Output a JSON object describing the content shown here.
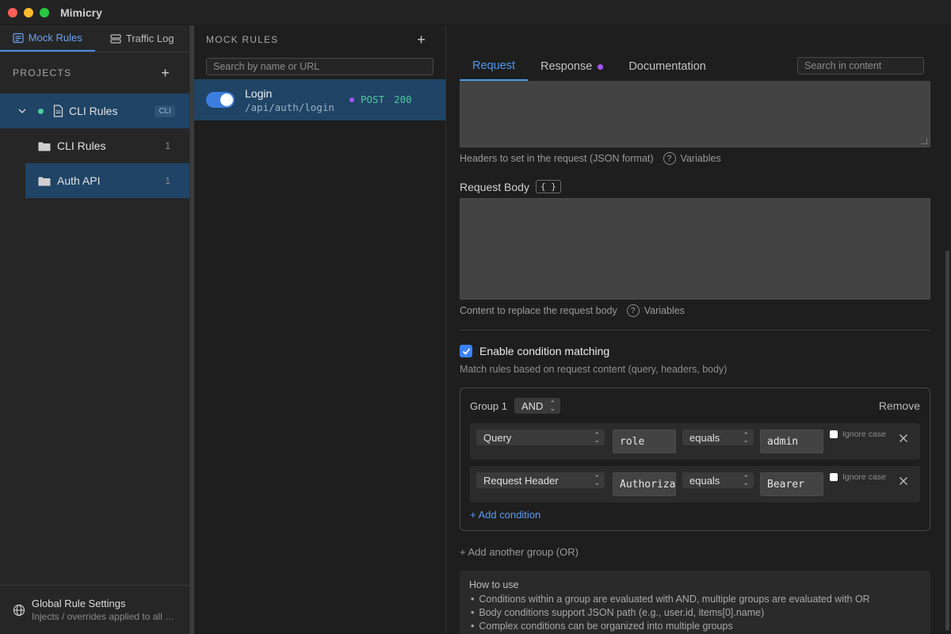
{
  "app": {
    "title": "Mimicry"
  },
  "sidebar": {
    "tabs": [
      {
        "label": "Mock Rules",
        "icon": "list-icon"
      },
      {
        "label": "Traffic Log",
        "icon": "server-icon"
      }
    ],
    "projects_label": "PROJECTS",
    "project": {
      "name": "CLI Rules",
      "badge": "CLI",
      "icon": "file-icon"
    },
    "folders": [
      {
        "name": "CLI Rules",
        "count": "1"
      },
      {
        "name": "Auth API",
        "count": "1"
      }
    ],
    "footer": {
      "title": "Global Rule Settings",
      "subtitle": "Injects / overrides applied to all rules",
      "icon": "globe-icon"
    }
  },
  "rules_panel": {
    "title": "MOCK RULES",
    "search_placeholder": "Search by name or URL",
    "rules": [
      {
        "name": "Login",
        "url": "/api/auth/login",
        "method": "POST",
        "status": "200",
        "enabled": true
      }
    ]
  },
  "main": {
    "tabs": [
      {
        "label": "Request"
      },
      {
        "label": "Response"
      },
      {
        "label": "Documentation"
      }
    ],
    "search_placeholder": "Search in content",
    "headers_hint": "Headers to set in the request (JSON format)",
    "variables_label": "Variables",
    "request_body_label": "Request Body",
    "braces_label": "{ }",
    "body_hint": "Content to replace the request body",
    "condition": {
      "title": "Enable condition matching",
      "description": "Match rules based on request content (query, headers, body)",
      "group": {
        "label": "Group 1",
        "operator": "AND",
        "remove_label": "Remove",
        "rows": [
          {
            "source": "Query",
            "key": "role",
            "op": "equals",
            "value": "admin",
            "ignore_case": "Ignore case"
          },
          {
            "source": "Request Header",
            "key": "Authorization",
            "op": "equals",
            "value": "Bearer",
            "ignore_case": "Ignore case"
          }
        ],
        "add_condition": "+ Add condition"
      },
      "add_group": "+ Add another group (OR)"
    },
    "howto": {
      "title": "How to use",
      "items": [
        "Conditions within a group are evaluated with AND, multiple groups are evaluated with OR",
        "Body conditions support JSON path (e.g., user.id, items[0].name)",
        "Complex conditions can be organized into multiple groups"
      ]
    }
  },
  "colors": {
    "accent": "#4d9af0",
    "selected": "#1f4466",
    "success": "#4ec9a0",
    "purple": "#a855f7"
  }
}
